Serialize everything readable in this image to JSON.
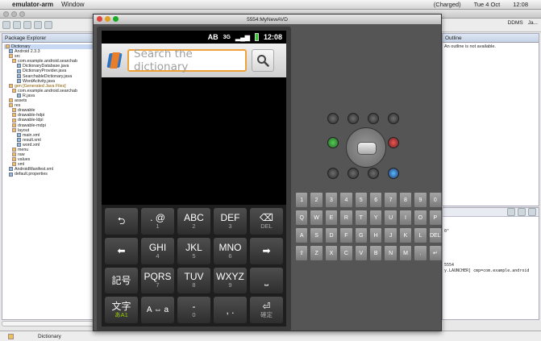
{
  "menubar": {
    "apple": "",
    "app": "emulator-arm",
    "window": "Window",
    "right": [
      "(Charged)",
      "Tue 4 Oct",
      "12:08"
    ]
  },
  "emulator": {
    "title": "5554:MyNewAVD"
  },
  "phone": {
    "status_time": "12:08",
    "status_ab": "AB",
    "search_placeholder": "Search the dictionary",
    "keys": [
      {
        "main": "⮌",
        "sub": ""
      },
      {
        "main": ". @",
        "sub": "1"
      },
      {
        "main": "ABC",
        "sub": "2"
      },
      {
        "main": "DEF",
        "sub": "3"
      },
      {
        "main": "⌫",
        "sub": "DEL"
      },
      {
        "main": "⬅",
        "sub": ""
      },
      {
        "main": "GHI",
        "sub": "4"
      },
      {
        "main": "JKL",
        "sub": "5"
      },
      {
        "main": "MNO",
        "sub": "6"
      },
      {
        "main": "➡",
        "sub": ""
      },
      {
        "main": "記号",
        "sub": ""
      },
      {
        "main": "PQRS",
        "sub": "7"
      },
      {
        "main": "TUV",
        "sub": "8"
      },
      {
        "main": "WXYZ",
        "sub": "9"
      },
      {
        "main": "⎵",
        "sub": ""
      },
      {
        "main": "文字",
        "sub": "あA1"
      },
      {
        "main": "A ⇔ a",
        "sub": ""
      },
      {
        "main": "-",
        "sub": "0"
      },
      {
        "main": ", .",
        "sub": ""
      },
      {
        "main": "⏎",
        "sub": "確定"
      }
    ]
  },
  "hw_keys": [
    "1",
    "2",
    "3",
    "4",
    "5",
    "6",
    "7",
    "8",
    "9",
    "0",
    "Q",
    "W",
    "E",
    "R",
    "T",
    "Y",
    "U",
    "I",
    "O",
    "P",
    "A",
    "S",
    "D",
    "F",
    "G",
    "H",
    "J",
    "K",
    "L",
    "DEL",
    "⇧",
    "Z",
    "X",
    "C",
    "V",
    "B",
    "N",
    "M",
    ".",
    "↵",
    "ALT",
    "SYM",
    "@",
    "",
    "",
    "",
    "/",
    ",",
    "",
    "ALT"
  ],
  "package_explorer": {
    "title": "Package Explorer",
    "items": [
      "Dictionary",
      "Android 2.3.3",
      "src",
      "com.example.android.searchab",
      "DictionaryDatabase.java",
      "DictionaryProvider.java",
      "SearchableDictionary.java",
      "WordActivity.java",
      "gen [Generated Java Files]",
      "com.example.android.searchab",
      "R.java",
      "assets",
      "res",
      "drawable",
      "drawable-hdpi",
      "drawable-ldpi",
      "drawable-mdpi",
      "layout",
      "main.xml",
      "result.xml",
      "word.xml",
      "menu",
      "raw",
      "values",
      "xml",
      "AndroidManifest.xml",
      "default.properties"
    ]
  },
  "outline": {
    "title": "Outline",
    "msg": "An outline is not available."
  },
  "perspectives": {
    "ddms": "DDMS",
    "java": "Ja..."
  },
  "console": {
    "lines": [
      "0\"",
      "5554",
      "y.LAUNCHER] cmp=com.example.android"
    ]
  },
  "status": {
    "label": "Dictionary"
  }
}
